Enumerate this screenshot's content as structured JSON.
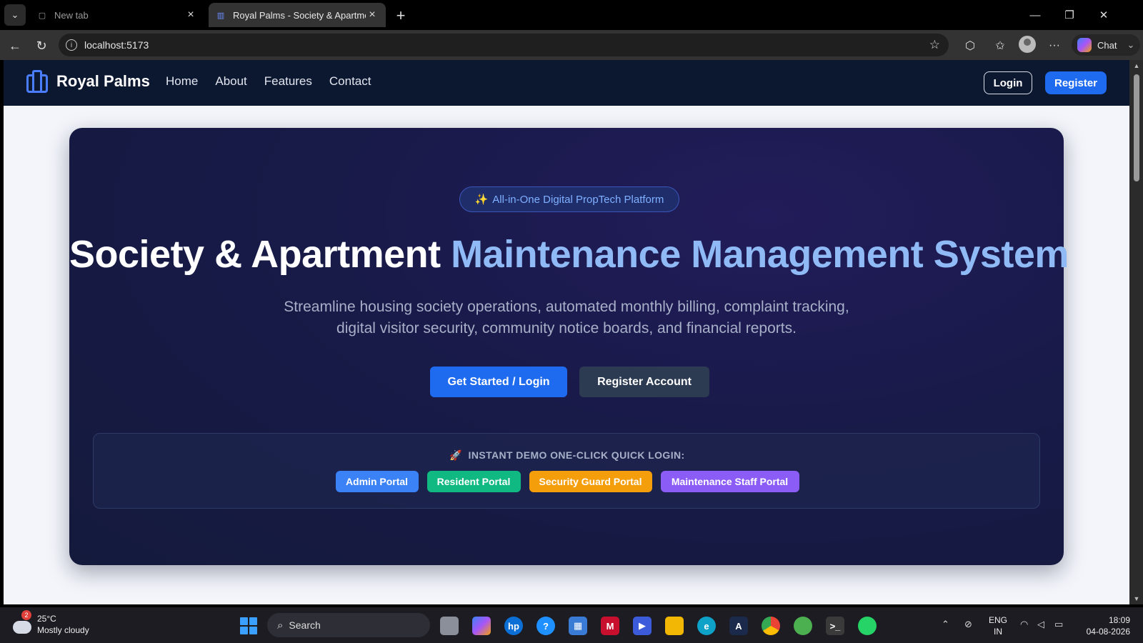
{
  "browser": {
    "tabs": [
      {
        "label": "New tab"
      },
      {
        "label": "Royal Palms - Society & Apartment"
      }
    ],
    "url": "localhost:5173",
    "chat_label": "Chat"
  },
  "nav": {
    "brand": "Royal Palms",
    "links": [
      "Home",
      "About",
      "Features",
      "Contact"
    ],
    "login_label": "Login",
    "register_label": "Register"
  },
  "hero": {
    "badge_icon": "✨",
    "badge": "All-in-One Digital PropTech Platform",
    "headline_part1": "Society & Apartment",
    "headline_part2": "Maintenance Management System",
    "subtitle": "Streamline housing society operations, automated monthly billing, complaint tracking, digital visitor security, community notice boards, and financial reports.",
    "cta_primary": "Get Started / Login",
    "cta_secondary": "Register Account"
  },
  "demo": {
    "icon": "🚀",
    "title": "INSTANT DEMO ONE-CLICK QUICK LOGIN:",
    "portals": [
      "Admin Portal",
      "Resident Portal",
      "Security Guard Portal",
      "Maintenance Staff Portal"
    ]
  },
  "taskbar": {
    "weather_badge": "2",
    "temperature": "25°C",
    "condition": "Mostly cloudy",
    "search_label": "Search",
    "lang_line1": "ENG",
    "lang_line2": "IN",
    "time": "18:09",
    "date": "04-08-2026"
  },
  "colors": {
    "nav_bg": "#0c1730",
    "accent_blue": "#1f6bf0",
    "headline_blue": "#8fbaf5",
    "portal_admin": "#3b82f6",
    "portal_resident": "#10b981",
    "portal_security": "#f59e0b",
    "portal_maintenance": "#8b5cf6"
  }
}
